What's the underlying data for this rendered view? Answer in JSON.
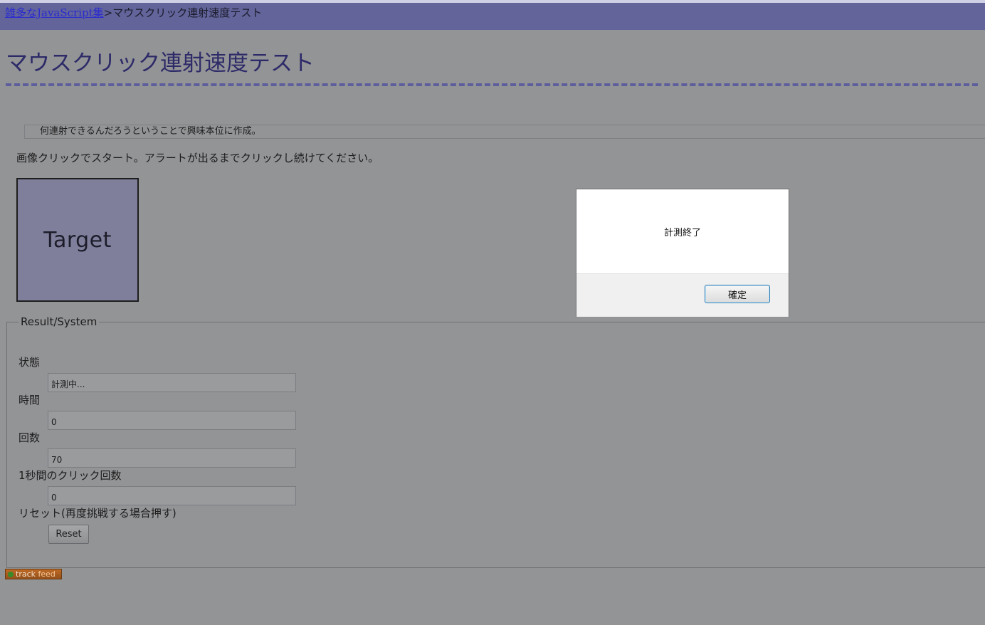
{
  "breadcrumb": {
    "link_label": "雑多なJavaScript集",
    "separator": ">",
    "current": "マウスクリック連射速度テスト"
  },
  "page_title": "マウスクリック連射速度テスト",
  "intro_text": "何連射できるんだろうということで興味本位に作成。",
  "instructions": "画像クリックでスタート。アラートが出るまでクリックし続けてください。",
  "target_label": "Target",
  "result": {
    "legend": "Result/System",
    "status_label": "状態",
    "status_value": "計測中...",
    "time_label": "時間",
    "time_value": "0",
    "count_label": "回数",
    "count_value": "70",
    "cps_label": "1秒間のクリック回数",
    "cps_value": "0",
    "reset_label": "リセット(再度挑戦する場合押す)",
    "reset_button": "Reset"
  },
  "badge": {
    "track": "track",
    "feed": "feed"
  },
  "alert_dialog": {
    "message": "計測終了",
    "ok_label": "確定"
  },
  "colors": {
    "overlay_background": "#939496",
    "header_bar": "#62649a",
    "title_text": "#2d2a68",
    "link": "#2b2bd0"
  }
}
